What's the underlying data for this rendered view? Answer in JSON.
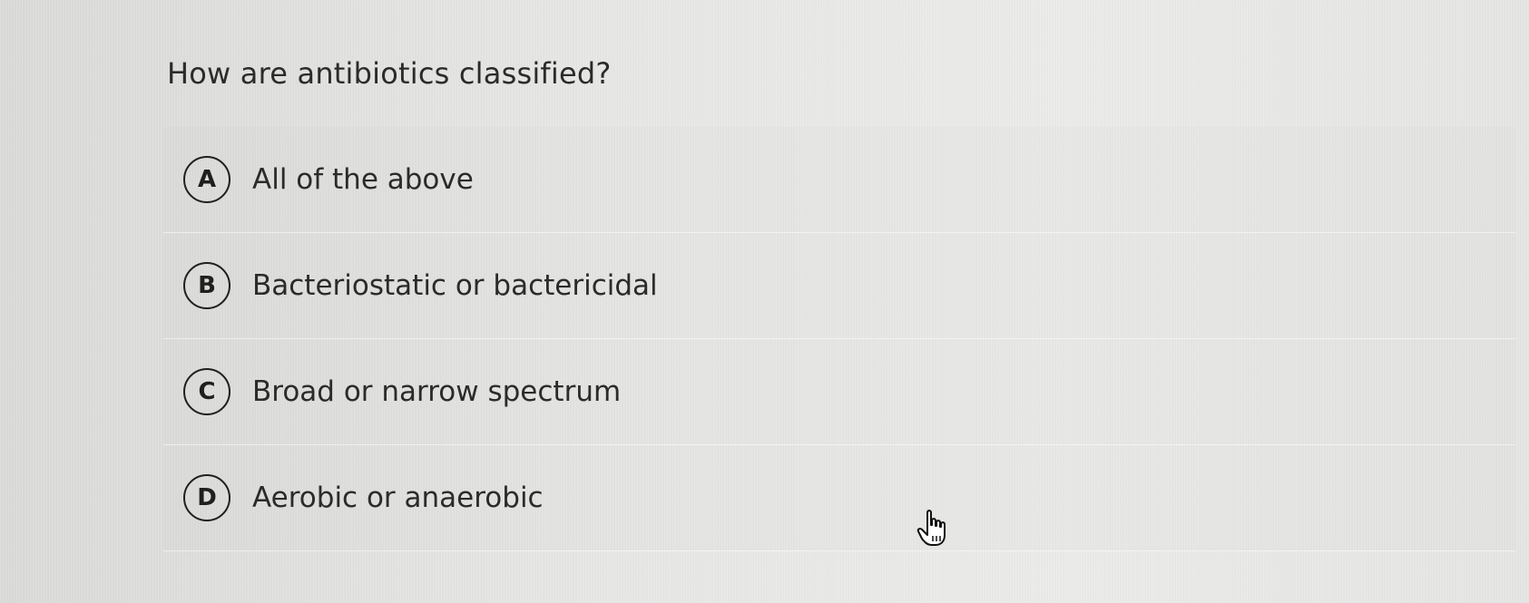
{
  "question": {
    "text": "How are antibiotics classified?"
  },
  "options": [
    {
      "letter": "A",
      "text": "All of the above"
    },
    {
      "letter": "B",
      "text": "Bacteriostatic or bactericidal"
    },
    {
      "letter": "C",
      "text": "Broad or narrow spectrum"
    },
    {
      "letter": "D",
      "text": "Aerobic or anaerobic"
    }
  ],
  "cursor": {
    "icon": "hand-pointer-icon"
  }
}
